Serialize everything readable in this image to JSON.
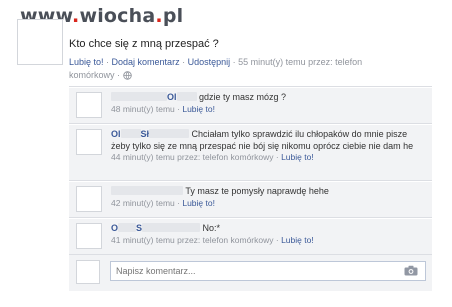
{
  "watermark": {
    "prefix": "www",
    "dot": ".",
    "name": "wiocha",
    "dot2": ".",
    "tld": "pl"
  },
  "post": {
    "text": "Kto chce się z mną przespać ?",
    "like": "Lubię to!",
    "comment": "Dodaj komentarz",
    "share": "Udostępnij",
    "time": "55 minut(y) temu przez: telefon",
    "time2": "komórkowy"
  },
  "comments": [
    {
      "name": "Ol",
      "text": "gdzie ty masz mózg ?",
      "time": "48 minut(y) temu",
      "like": "Lubię to!"
    },
    {
      "name": "Ol",
      "name2": "Sł",
      "text": "Chciałam tylko sprawdzić ilu chłopaków do mnie pisze żeby tylko się ze mną przespać nie bój się nikomu oprócz ciebie nie dam he",
      "time": "44 minut(y) temu przez: telefon komórkowy",
      "like": "Lubię to!"
    },
    {
      "name": "",
      "text": "Ty masz te pomysły naprawdę hehe",
      "time": "42 minut(y) temu",
      "like": "Lubię to!"
    },
    {
      "name": "O",
      "name2": "S",
      "text": "No:*",
      "time": "41 minut(y) temu przez: telefon komórkowy",
      "like": "Lubię to!"
    }
  ],
  "composer": {
    "placeholder": "Napisz komentarz..."
  },
  "separator": " · ",
  "colors": {
    "link": "#3b5998",
    "meta": "#90949c",
    "panel": "#f2f3f5"
  }
}
